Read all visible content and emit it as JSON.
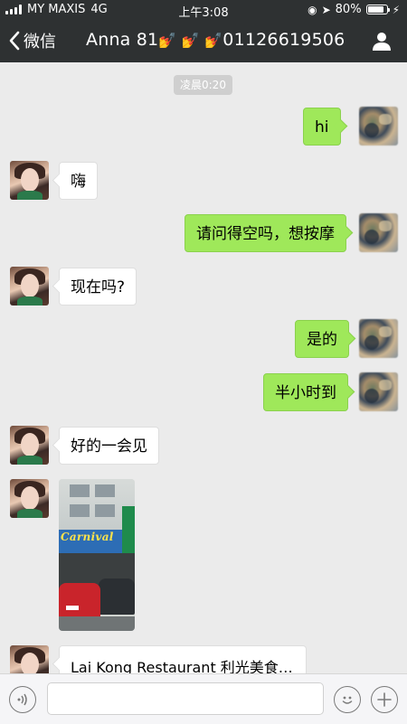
{
  "status_bar": {
    "carrier": "MY MAXIS",
    "network": "4G",
    "time": "上午3:08",
    "battery": "80%"
  },
  "nav": {
    "back_label": "微信",
    "contact_title": "Anna 81",
    "contact_emojis": "💅 💅 💅",
    "contact_phone": "01126619506"
  },
  "chat": {
    "time_tag": "凌晨0:20",
    "messages": [
      {
        "from": "me",
        "text": "hi"
      },
      {
        "from": "her",
        "text": "嗨"
      },
      {
        "from": "me",
        "text": "请问得空吗，想按摩"
      },
      {
        "from": "her",
        "text": "现在吗?"
      },
      {
        "from": "me",
        "text": "是的"
      },
      {
        "from": "me",
        "text": "半小时到"
      },
      {
        "from": "her",
        "text": "好的一会见"
      },
      {
        "from": "her",
        "type": "image",
        "sign_text": "Carnival"
      },
      {
        "from": "her",
        "type": "link",
        "text": "Lai Kong Restaurant 利光美食…"
      }
    ]
  },
  "input_bar": {
    "placeholder": ""
  },
  "colors": {
    "top_bar": "#2e3132",
    "chat_bg": "#ebebeb",
    "bubble_out": "#9fe85a",
    "bubble_in": "#ffffff"
  },
  "icons": {
    "voice": "voice-icon",
    "emoji": "emoji-icon",
    "more": "plus-icon",
    "profile": "person-icon",
    "back": "chevron-left-icon"
  }
}
